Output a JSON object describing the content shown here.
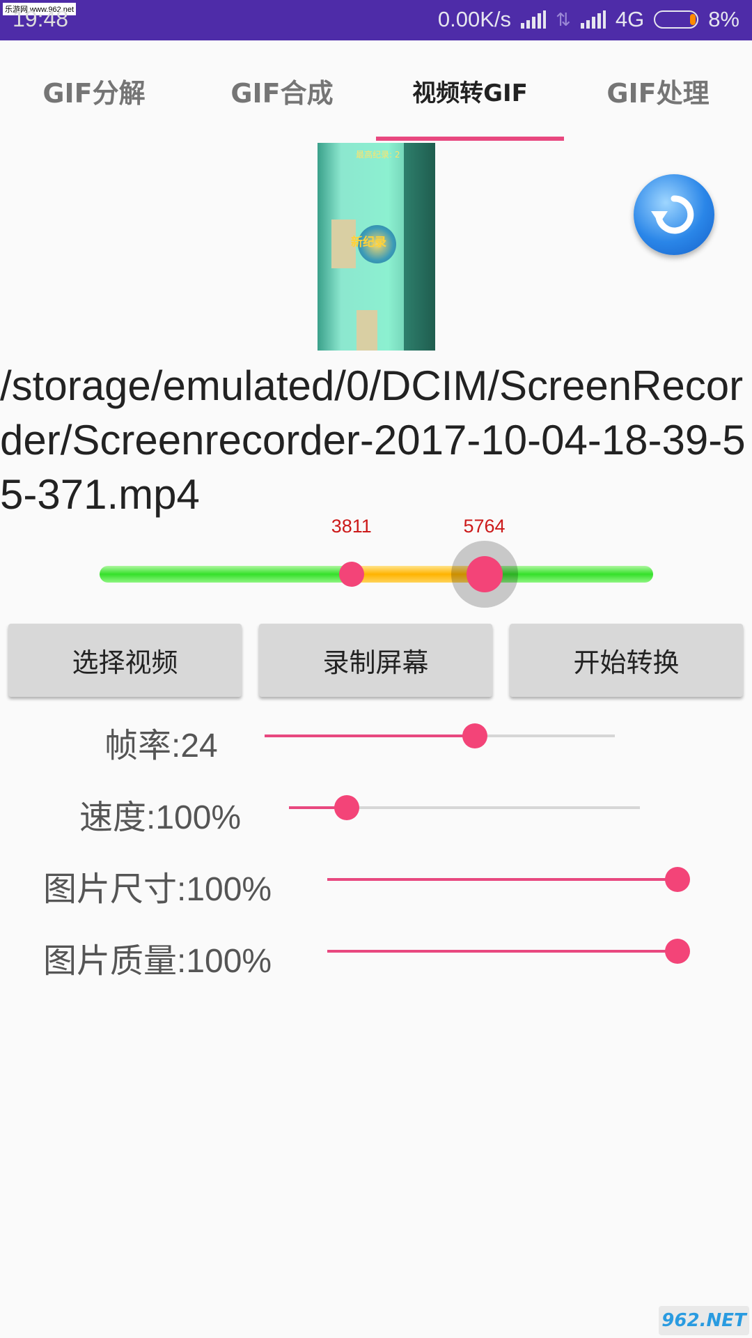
{
  "status_bar": {
    "time": "19:48",
    "watermark": "乐游网 www.962.net",
    "net_speed": "0.00K/s",
    "network": "4G",
    "battery": "8%"
  },
  "tabs": [
    {
      "label": "GIF分解"
    },
    {
      "label": "GIF合成"
    },
    {
      "label": "视频转GIF",
      "active": true
    },
    {
      "label": "GIF处理"
    }
  ],
  "thumbnail": {
    "overlay_top": "最高纪录: 2",
    "overlay_badge": "新纪录"
  },
  "file_path": "/storage/emulated/0/DCIM/ScreenRecorder/Screenrecorder-2017-10-04-18-39-55-371.mp4",
  "range": {
    "start_label": "3811",
    "end_label": "5764",
    "start_fraction": 0.455,
    "end_fraction": 0.695
  },
  "buttons": {
    "select_video": "选择视频",
    "record_screen": "录制屏幕",
    "start_convert": "开始转换"
  },
  "params": [
    {
      "label": "帧率:24",
      "fraction": 0.6
    },
    {
      "label": "速度:100%",
      "fraction": 0.165
    },
    {
      "label": "图片尺寸:100%",
      "fraction": 1.0
    },
    {
      "label": "图片质量:100%",
      "fraction": 1.0
    }
  ],
  "site_watermark": "962.NET",
  "colors": {
    "accent": "#e8487f",
    "status_bar": "#4e2ca8",
    "range_label": "#cc1a1a"
  },
  "icons": [
    "signal-icon",
    "data-arrows-icon",
    "battery-icon",
    "refresh-icon"
  ]
}
